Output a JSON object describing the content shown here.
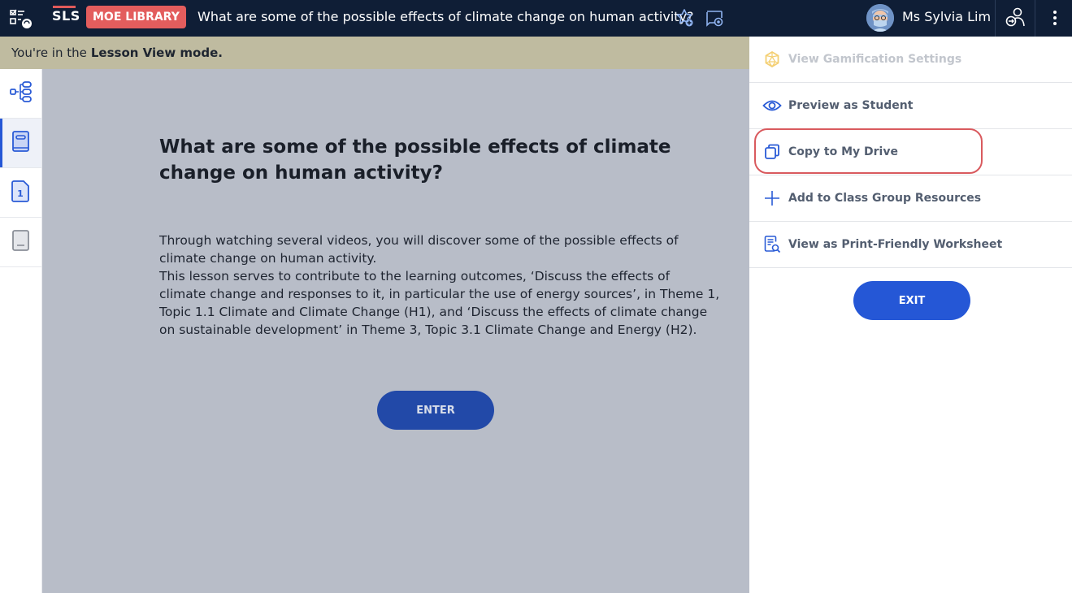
{
  "topbar": {
    "brand": "SLS",
    "library_badge": "MOE LIBRARY",
    "lesson_title": "What are some of the possible effects of climate change on human activity?",
    "user_name": "Ms Sylvia Lim",
    "icons": [
      "assignment-menu-icon",
      "favourite-add-icon",
      "comment-icon",
      "avatar",
      "switch-role-icon",
      "more-vertical-icon"
    ]
  },
  "banner": {
    "prefix": "You're in the",
    "mode": "Lesson View mode."
  },
  "leftnav": {
    "items": [
      {
        "name": "lesson-map",
        "icon": "tree-structure-icon",
        "active": false
      },
      {
        "name": "lesson-cover",
        "icon": "book-icon",
        "active": true
      },
      {
        "name": "page-1",
        "icon": "page-number-icon",
        "label": "1",
        "active": false
      },
      {
        "name": "lesson-end",
        "icon": "closed-book-icon",
        "active": false
      }
    ]
  },
  "main": {
    "title": "What are some of the possible effects of climate change on human activity?",
    "paragraph1": "Through watching several videos, you will discover some of the possible effects of climate change on human activity.",
    "paragraph2": "This lesson serves to contribute to the learning outcomes, ‘Discuss the effects of climate change and responses to it, in particular the use of energy sources’, in Theme 1, Topic 1.1 Climate and Climate Change (H1), and ‘Discuss the effects of climate change on sustainable development’ in Theme 3, Topic 3.1 Climate Change and Energy (H2).",
    "enter_label": "ENTER"
  },
  "panel": {
    "items": [
      {
        "label": "View Gamification Settings",
        "icon": "gamification-icon",
        "disabled": true
      },
      {
        "label": "Preview as Student",
        "icon": "eye-icon",
        "disabled": false
      },
      {
        "label": "Copy to My Drive",
        "icon": "copy-icon",
        "disabled": false,
        "highlighted": true
      },
      {
        "label": "Add to Class Group Resources",
        "icon": "plus-icon",
        "disabled": false
      },
      {
        "label": "View as Print-Friendly Worksheet",
        "icon": "worksheet-search-icon",
        "disabled": false
      }
    ],
    "exit_label": "EXIT"
  },
  "colors": {
    "topbar": "#0f1e36",
    "badge": "#e35d5d",
    "banner": "#bfbba0",
    "main_bg": "#b8bdc8",
    "primary": "#2557d6",
    "highlight": "#d95a5e"
  }
}
